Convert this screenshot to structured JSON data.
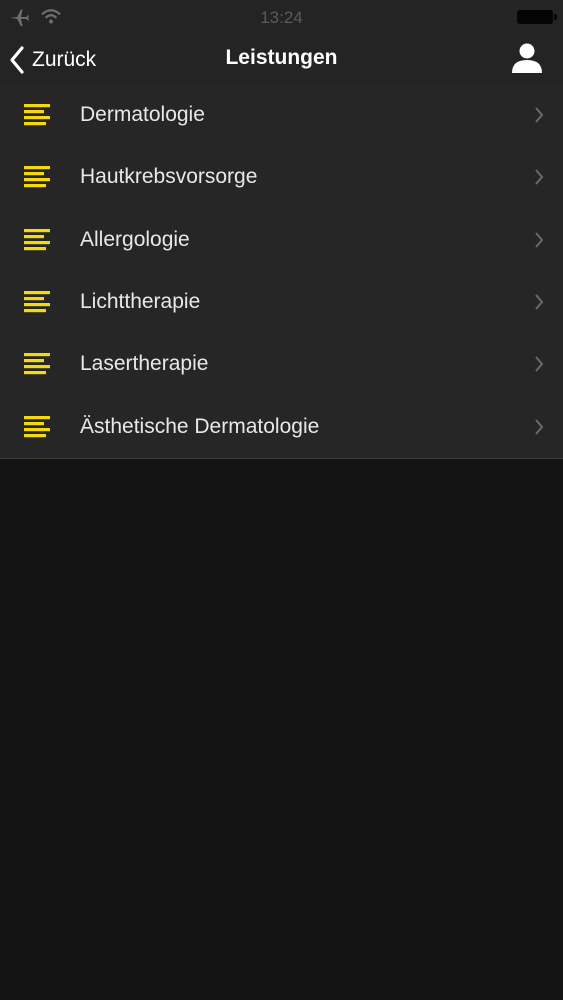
{
  "status_bar": {
    "time": "13:24",
    "icons": [
      "airplane-icon",
      "wifi-icon",
      "battery-icon"
    ]
  },
  "nav": {
    "back_label": "Zurück",
    "title": "Leistungen",
    "profile_icon": "person-icon"
  },
  "list": {
    "items": [
      {
        "label": "Dermatologie"
      },
      {
        "label": "Hautkrebsvorsorge"
      },
      {
        "label": "Allergologie"
      },
      {
        "label": "Lichttherapie"
      },
      {
        "label": "Lasertherapie"
      },
      {
        "label": "Ästhetische Dermatologie"
      }
    ],
    "item_icon": "list-lines-icon"
  },
  "colors": {
    "accent": "#f5d90a",
    "bar_background": "#242424",
    "list_background": "#262626",
    "screen_background": "#141414",
    "chevron": "#6a6a6a"
  }
}
